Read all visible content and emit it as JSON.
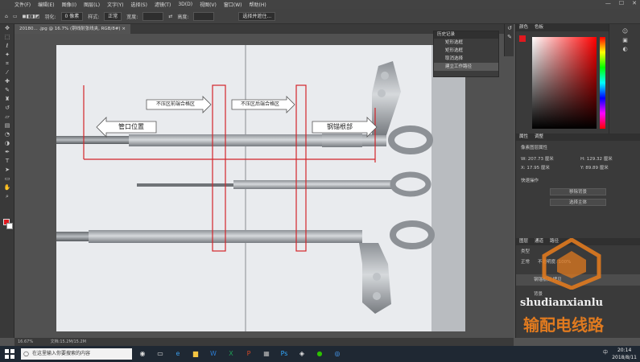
{
  "app": {
    "logo": "Ps"
  },
  "menu": [
    "文件(F)",
    "编辑(E)",
    "图像(I)",
    "图层(L)",
    "文字(Y)",
    "选择(S)",
    "滤镜(T)",
    "3D(D)",
    "视图(V)",
    "窗口(W)",
    "帮助(H)"
  ],
  "window_controls": [
    "—",
    "☐",
    "✕"
  ],
  "options": {
    "feather_label": "羽化:",
    "feather_value": "0 像素",
    "style_label": "样式:",
    "style_value": "正常",
    "width_label": "宽度:",
    "height_label": "高度:",
    "select_mask": "选择并遮住..."
  },
  "doc_tab": "20180... .jpg @ 16.7% (铜线耐张线夹, RGB/8#) ×",
  "canvas_labels": {
    "zone1": "不压区前端合格区",
    "zone2": "不压区后端合格区",
    "pipe_position": "管口位置",
    "anchor_root": "钢锚根部"
  },
  "status": {
    "zoom": "16.67%",
    "doc": "文档:15.2M/15.2M"
  },
  "history_panel": {
    "title": "历史记录",
    "items": [
      "矩形选框",
      "矩形选框",
      "取消选择",
      "建立工作路径"
    ]
  },
  "color_panel": {
    "tabs": [
      "颜色",
      "色板"
    ]
  },
  "properties_panel": {
    "tabs": [
      "属性",
      "调整"
    ],
    "title": "像素图层属性",
    "fields": [
      "W: 207.73 厘米",
      "H: 129.32 厘米",
      "X: 17.95 厘米",
      "Y: 89.89 厘米"
    ],
    "section": "快速操作",
    "btn1": "移除背景",
    "btn2": "选择主体"
  },
  "layers_panel": {
    "tabs": [
      "图层",
      "通道",
      "路径"
    ],
    "kind": "类型",
    "blend": "正常",
    "opacity": "不透明度: 100%",
    "layers": [
      "钢锚根部 拷贝",
      "背景"
    ]
  },
  "taskbar": {
    "search_placeholder": "在这里输入你要搜索的内容",
    "time": "20:14",
    "date": "2018/8/11",
    "ime": "中"
  },
  "watermark": {
    "site": "shudianxianlu",
    "title": "输配电线路"
  },
  "colors": {
    "fg": "#e0191f",
    "bg": "#ffffff",
    "annotation": "#d3242a",
    "accent": "#e07a1f"
  },
  "tools": [
    "move-icon",
    "marquee-icon",
    "lasso-icon",
    "wand-icon",
    "crop-icon",
    "eyedropper-icon",
    "heal-icon",
    "brush-icon",
    "stamp-icon",
    "history-brush-icon",
    "eraser-icon",
    "gradient-icon",
    "blur-icon",
    "dodge-icon",
    "pen-icon",
    "type-icon",
    "path-select-icon",
    "shape-icon",
    "hand-icon",
    "zoom-icon"
  ]
}
